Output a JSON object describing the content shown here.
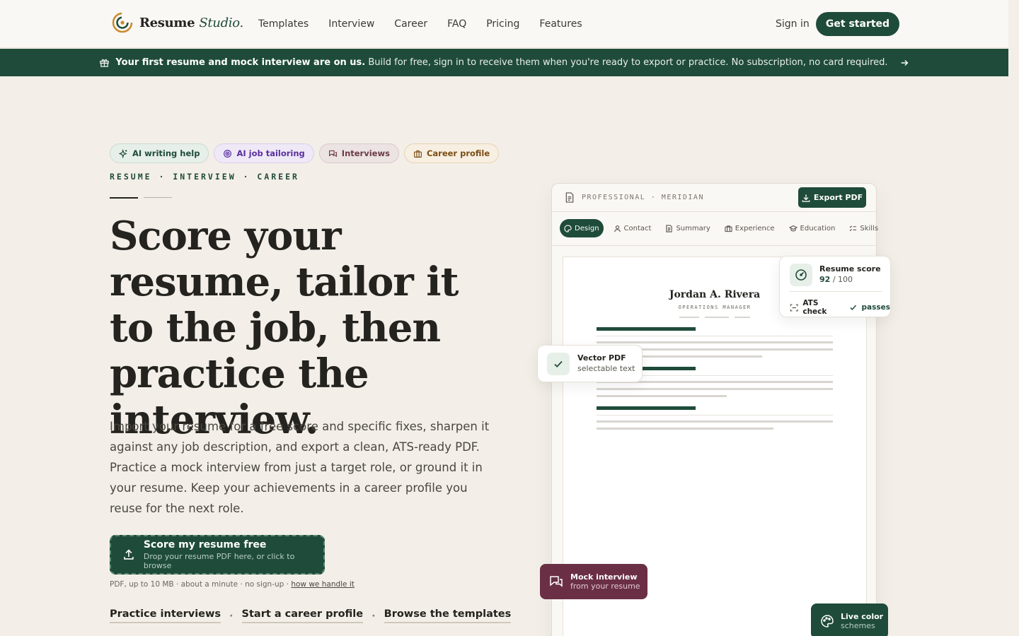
{
  "nav": {
    "brand_main": "Resume",
    "brand_accent": "Studio.",
    "links": [
      "Templates",
      "Interview",
      "Career",
      "FAQ",
      "Pricing",
      "Features"
    ],
    "signin": "Sign in",
    "cta": "Get started"
  },
  "banner": {
    "bold": "Your first resume and mock interview are on us.",
    "rest": "Build for free, sign in to receive them when you're ready to export or practice. No subscription, no card required."
  },
  "hero": {
    "chips": [
      "AI writing help",
      "AI job tailoring",
      "Interviews",
      "Career profile"
    ],
    "eyebrow": "RESUME · INTERVIEW · CAREER",
    "title": "Score your resume, tailor it to the job, then practice the interview.",
    "lead": "Import your resume for a free score and specific fixes, sharpen it against any job description, and export a clean, ATS-ready PDF. Practice a mock interview from just a target role, or ground it in your resume. Keep your achievements in a career profile you reuse for the next role.",
    "upload_title": "Score my resume free",
    "upload_sub": "Drop your resume PDF here, or click to browse",
    "fineprint": "PDF, up to 10 MB · about a minute · no sign-up ·",
    "fineprint_link": "how we handle it",
    "secondary_links": [
      "Practice interviews",
      "Start a career profile",
      "Browse the templates"
    ],
    "separator": "·"
  },
  "preview": {
    "header": "PROFESSIONAL · MERIDIAN",
    "export": "Export PDF",
    "tabs": [
      "Design",
      "Contact",
      "Summary",
      "Experience",
      "Education",
      "Skills"
    ],
    "name": "Jordan A. Rivera",
    "role": "OPERATIONS MANAGER",
    "score_title": "Resume score",
    "score_value": "92",
    "score_max": "/ 100",
    "ats_label": "ATS check",
    "ats_status": "passes",
    "vector_title": "Vector PDF",
    "vector_sub": "selectable text",
    "mock_title": "Mock interview",
    "mock_sub": "from your resume",
    "live_title": "Live color",
    "live_sub": "schemes"
  },
  "colors": {
    "brand": "#1f4b3a",
    "plum": "#6a2f45",
    "background": "#f3efe8"
  }
}
